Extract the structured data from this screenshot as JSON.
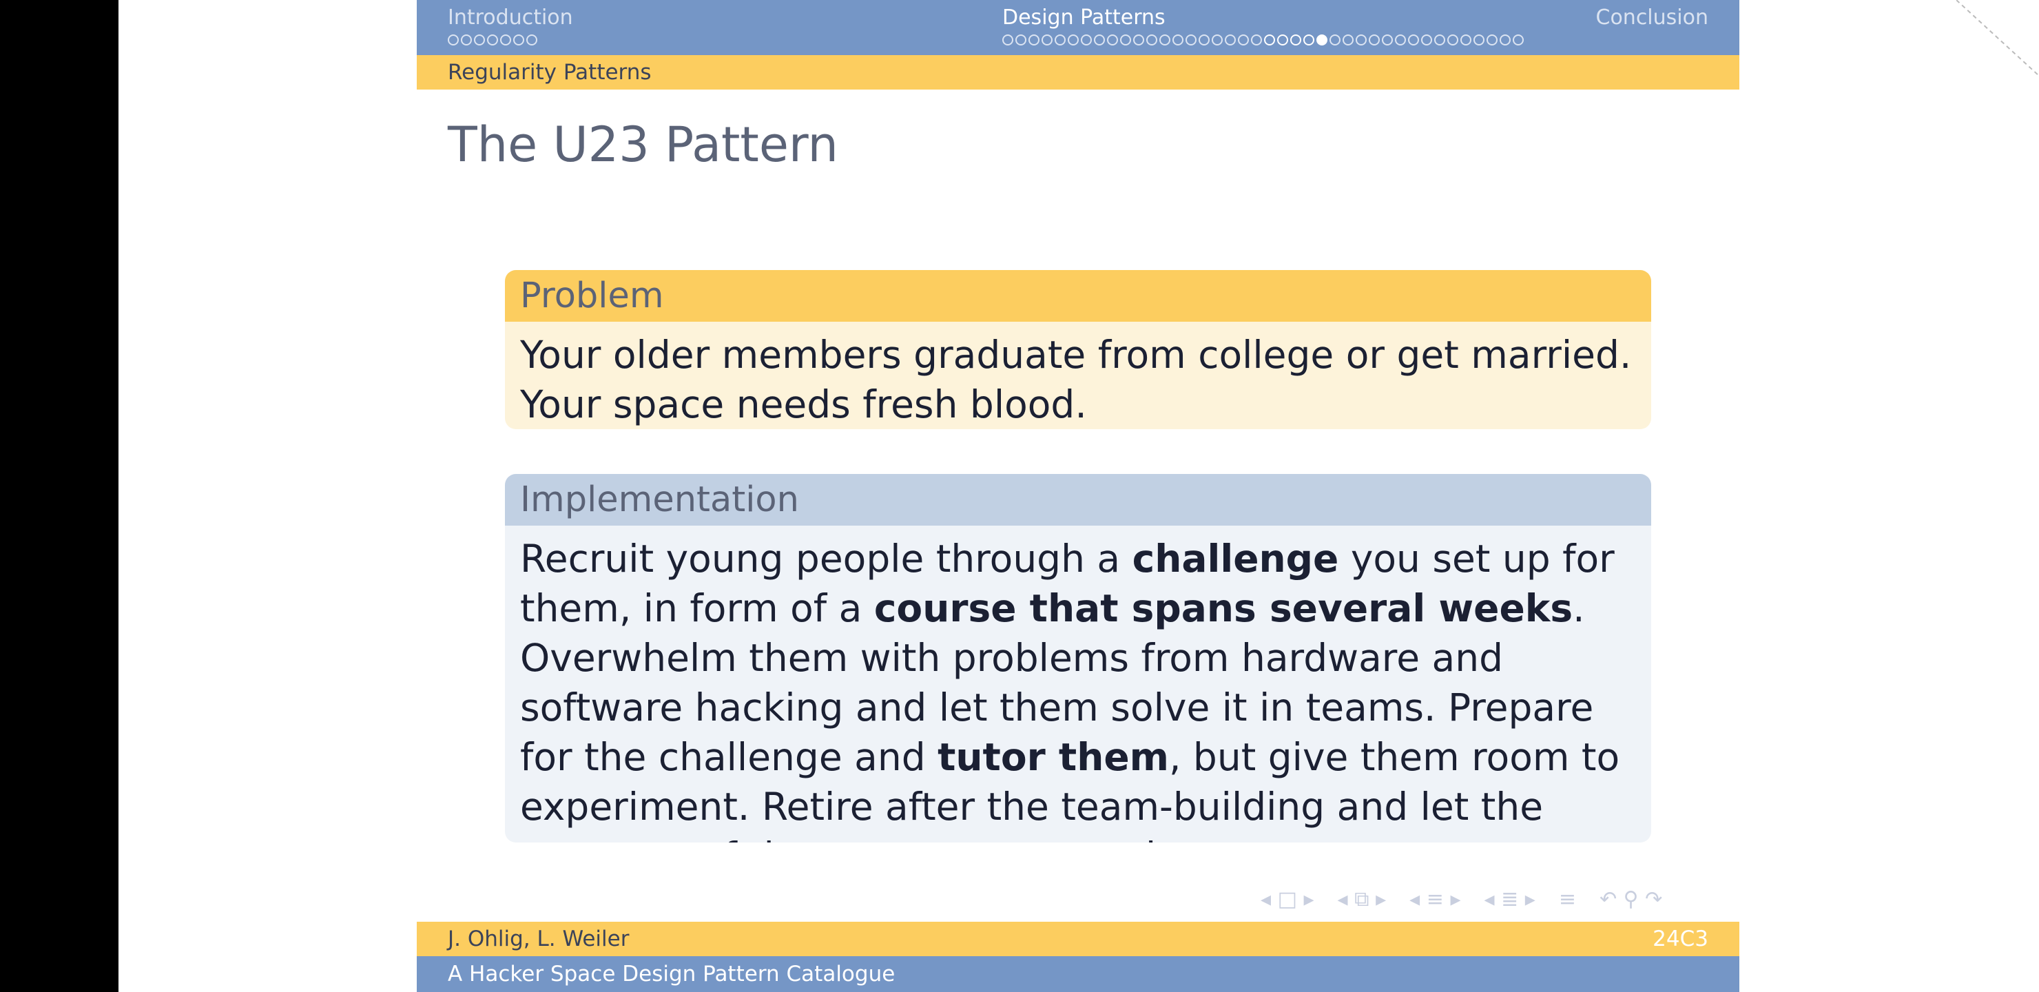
{
  "nav": {
    "sections": [
      {
        "label": "Introduction",
        "dots": 7,
        "current": -1
      },
      {
        "label": "Design Patterns",
        "dots": 40,
        "current": 24,
        "highlight_from": 20,
        "highlight_to": 24
      },
      {
        "label": "Conclusion",
        "dots": 0,
        "current": -1
      }
    ],
    "active_section": "Design Patterns"
  },
  "subsection": "Regularity Patterns",
  "frame_title": "The U23 Pattern",
  "problem": {
    "title": "Problem",
    "body": "Your older members graduate from college or get married. Your space needs fresh blood."
  },
  "implementation": {
    "title": "Implementation",
    "parts": [
      {
        "text": "Recruit young people through a ",
        "bold": false
      },
      {
        "text": "challenge",
        "bold": true
      },
      {
        "text": " you set up for them, in form of a ",
        "bold": false
      },
      {
        "text": "course that spans several weeks",
        "bold": true
      },
      {
        "text": ". Overwhelm them with problems from hardware and software hacking and let them solve it in teams. Prepare for the challenge and ",
        "bold": false
      },
      {
        "text": "tutor them",
        "bold": true
      },
      {
        "text": ", but give them room to experiment. Retire after the team-building and let the smartest of the young ones run the space.",
        "bold": false
      }
    ]
  },
  "footer": {
    "authors": "J. Ohlig, L. Weiler",
    "page": "24C3",
    "title": "A Hacker Space Design Pattern Catalogue"
  },
  "colors": {
    "blue": "#7596c6",
    "yellow": "#fccd5f",
    "problem_body": "#fdf3da",
    "impl_head": "#c1d0e3",
    "impl_body": "#eff3f8"
  }
}
